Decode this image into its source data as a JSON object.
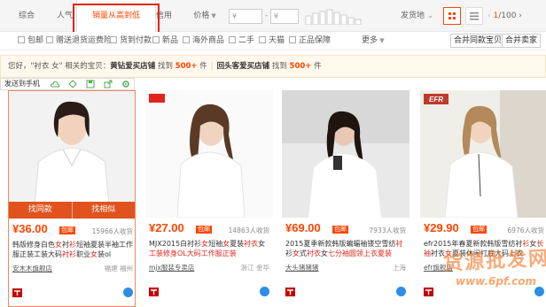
{
  "sort_tabs": [
    "综合",
    "人气",
    "销量从高到低",
    "信用",
    "价格"
  ],
  "price_filter": {
    "min_placeholder": "¥",
    "max_placeholder": "¥",
    "dash": "-"
  },
  "shipping_location": "发货地",
  "pager": {
    "current": "1",
    "total": "/100"
  },
  "filters": [
    "包邮",
    "赠送退货运费险",
    "货到付款",
    "新品",
    "海外商品",
    "二手",
    "天猫",
    "正品保障"
  ],
  "more_label": "更多",
  "merge_buttons": [
    "合并同款宝贝",
    "合并卖家"
  ],
  "notice": {
    "prefix": "您好，\"衬衣 女\" 相关的宝贝：",
    "shop1": "黄钻爱买店铺",
    "mid1": " 找到 ",
    "count1": "500+",
    "suffix1": " 件",
    "sep": "|",
    "shop2": "回头客爱买店铺",
    "mid2": " 找到 ",
    "count2": "500+",
    "suffix2": " 件"
  },
  "hover_toolbar": {
    "label": "发送到手机"
  },
  "card_actions": {
    "find_same": "找同款",
    "find_similar": "找相似"
  },
  "promo_badge": "包邮",
  "products": [
    {
      "price": "¥36.00",
      "sold": "15966人收货",
      "title_parts": [
        "韩版修身白色",
        "女",
        "衬",
        "衫",
        "短袖夏装半袖工作服正装工装大码",
        "衬衫",
        "职业",
        "女",
        "装ol"
      ],
      "shop": "安木木旗舰店",
      "location": "福建 福州"
    },
    {
      "price": "¥27.00",
      "sold": "14863人收货",
      "title_parts": [
        "MJX2015白衬衫",
        "女",
        "短袖",
        "女",
        "夏装",
        "衬衣",
        "女",
        "工装修身OL大码工作服正装",
        "",
        ""
      ],
      "shop": "mjx服装专卖店",
      "location": "浙江 金华"
    },
    {
      "price": "¥69.00",
      "sold": "7933人收货",
      "title_parts": [
        "2015夏季新款韩版蝙蝠袖镂空雪纺",
        "衬",
        "衫",
        "女",
        "式",
        "衬衣",
        "女",
        "七分袖圆领上衣夏装",
        "",
        ""
      ],
      "shop": "大头猪猪猪",
      "location": "上海"
    },
    {
      "price": "¥29.90",
      "sold": "6976人收货",
      "title_parts": [
        "efr2015年春夏新款韩版雪纺衬",
        "衫",
        "女",
        "长袖",
        "衬衣",
        "女",
        "夏装休闲打底大码上衣",
        "",
        "",
        ""
      ],
      "shop": "efr旗舰店",
      "location": ""
    }
  ],
  "watermark": {
    "line1": "货源批发网",
    "line2": "www.6pf.com"
  },
  "colors": {
    "accent": "#ff4400",
    "action": "#e1531e",
    "highlight_box": "#e1251b",
    "wangwang": "#2e8ee5"
  }
}
